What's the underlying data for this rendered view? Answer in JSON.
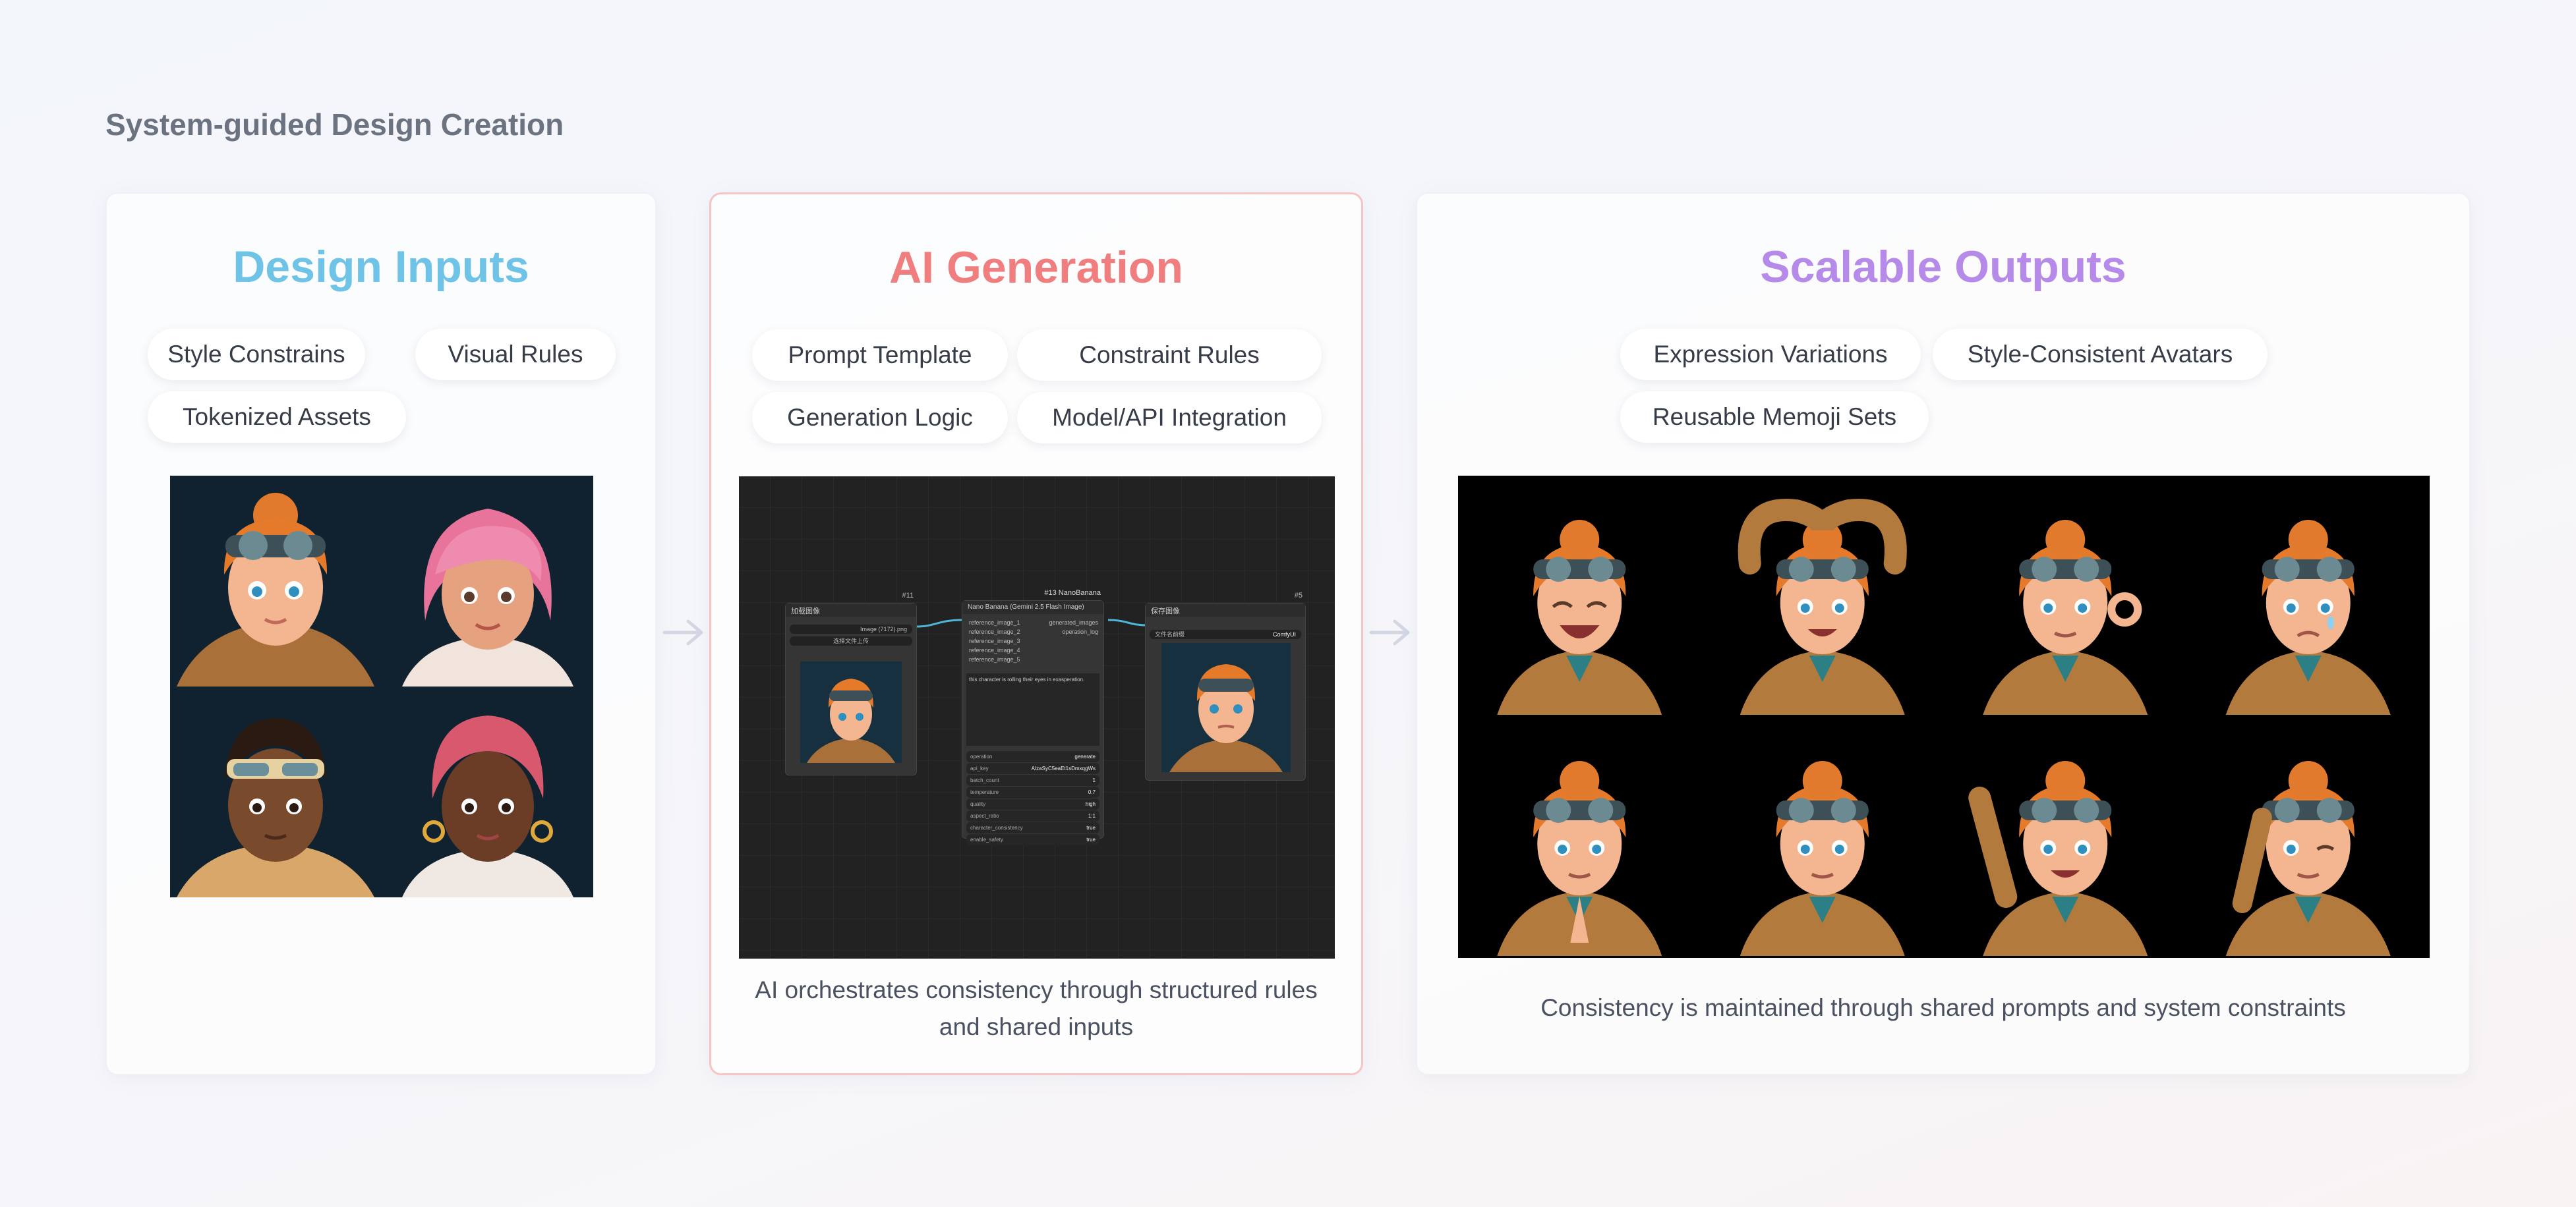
{
  "page": {
    "heading": "System-guided Design Creation"
  },
  "colors": {
    "inputs": "#6ec3e6",
    "generation": "#f07e7e",
    "outputs": "#b58ae8",
    "arrow": "#d3d7e3"
  },
  "inputs_card": {
    "title": "Design Inputs",
    "tags": [
      "Style Constrains",
      "Visual Rules",
      "Tokenized Assets"
    ]
  },
  "generation_card": {
    "title": "AI Generation",
    "tags": [
      "Prompt Template",
      "Constraint Rules",
      "Generation Logic",
      "Model/API Integration"
    ],
    "caption_line1": "AI orchestrates consistency through structured rules",
    "caption_line2": "and shared inputs",
    "node_graph": {
      "left_node": {
        "id": "#11",
        "title": "加载图像",
        "field": "Image (7172).png",
        "button": "选择文件上传"
      },
      "center_node": {
        "id": "#13 NanoBanana",
        "title": "Nano Banana (Gemini 2.5 Flash Image)",
        "inputs": [
          "reference_image_1",
          "reference_image_2",
          "reference_image_3",
          "reference_image_4",
          "reference_image_5"
        ],
        "outputs": [
          "generated_images",
          "operation_log"
        ],
        "prompt": "this character is rolling their eyes in exasperation.",
        "params": [
          {
            "name": "operation",
            "value": "generate"
          },
          {
            "name": "api_key",
            "value": "AIzaSyC5eaEt1sDmxqgWs"
          },
          {
            "name": "batch_count",
            "value": "1"
          },
          {
            "name": "temperature",
            "value": "0.7"
          },
          {
            "name": "quality",
            "value": "high"
          },
          {
            "name": "aspect_ratio",
            "value": "1:1"
          },
          {
            "name": "character_consistency",
            "value": "true"
          },
          {
            "name": "enable_safety",
            "value": "true"
          }
        ]
      },
      "right_node": {
        "id": "#5",
        "title": "保存图像",
        "field": "文件名前缀",
        "value": "ComfyUI"
      }
    }
  },
  "outputs_card": {
    "title": "Scalable Outputs",
    "tags": [
      "Expression Variations",
      "Style-Consistent Avatars",
      "Reusable Memoji Sets"
    ],
    "caption": "Consistency is maintained through shared prompts and system constraints",
    "expressions": [
      "laughing",
      "heart-hands",
      "ok-sign",
      "crying",
      "praying",
      "skeptical",
      "waving",
      "saluting-wink"
    ]
  }
}
